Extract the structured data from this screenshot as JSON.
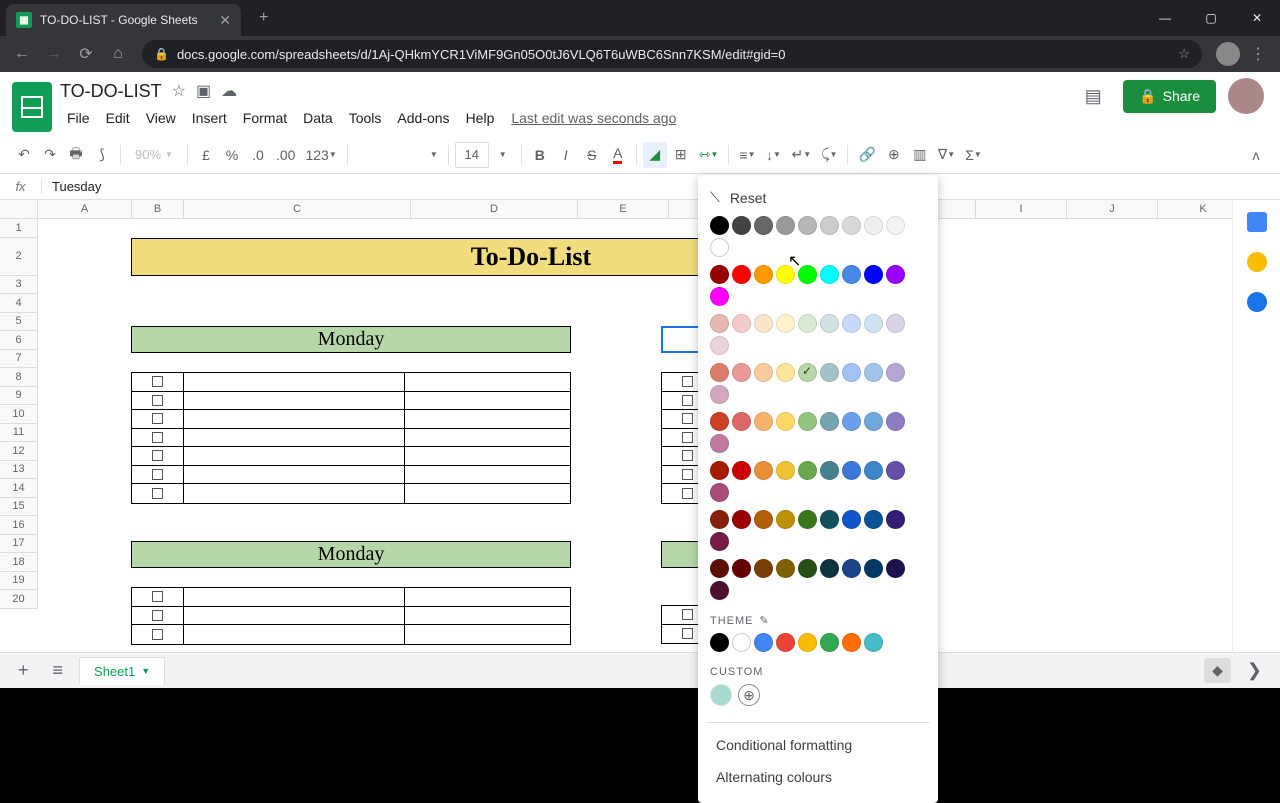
{
  "browser": {
    "tab_title": "TO-DO-LIST - Google Sheets",
    "url_display": "docs.google.com/spreadsheets/d/1Aj-QHkmYCR1ViMF9Gn05O0tJ6VLQ6T6uWBC6Snn7KSM/edit#gid=0"
  },
  "doc": {
    "title": "TO-DO-LIST",
    "menus": [
      "File",
      "Edit",
      "View",
      "Insert",
      "Format",
      "Data",
      "Tools",
      "Add-ons",
      "Help"
    ],
    "last_edit": "Last edit was seconds ago"
  },
  "share": {
    "label": "Share"
  },
  "toolbar": {
    "zoom": "90%",
    "font": "",
    "font_size": "14"
  },
  "fx": {
    "value": "Tuesday"
  },
  "columns": {
    "labels": [
      "A",
      "B",
      "C",
      "D",
      "E",
      "",
      "",
      "",
      "I",
      "J",
      "K"
    ],
    "widths": [
      94,
      52,
      227,
      167,
      91,
      81,
      113,
      113,
      91,
      91,
      91
    ]
  },
  "rows": {
    "count": 20,
    "tall_row": 2
  },
  "todotitle": "To-Do-List",
  "day_headers": {
    "left1": "Monday",
    "left2": "Monday"
  },
  "color_picker": {
    "reset": "Reset",
    "theme_label": "THEME",
    "custom_label": "CUSTOM",
    "conditional": "Conditional formatting",
    "alternating": "Alternating colours",
    "standard_grays": [
      "#000000",
      "#434343",
      "#666666",
      "#999999",
      "#b7b7b7",
      "#cccccc",
      "#d9d9d9",
      "#efefef",
      "#f3f3f3",
      "#ffffff"
    ],
    "standard_brights": [
      "#980000",
      "#ff0000",
      "#ff9900",
      "#ffff00",
      "#00ff00",
      "#00ffff",
      "#4a86e8",
      "#0000ff",
      "#9900ff",
      "#ff00ff"
    ],
    "shade_rows": [
      [
        "#e6b8af",
        "#f4cccc",
        "#fce5cd",
        "#fff2cc",
        "#d9ead3",
        "#d0e0e3",
        "#c9daf8",
        "#cfe2f3",
        "#d9d2e9",
        "#ead1dc"
      ],
      [
        "#dd7e6b",
        "#ea9999",
        "#f9cb9c",
        "#ffe599",
        "#b6d7a8",
        "#a2c4c9",
        "#a4c2f4",
        "#9fc5e8",
        "#b4a7d6",
        "#d5a6bd"
      ],
      [
        "#cc4125",
        "#e06666",
        "#f6b26b",
        "#ffd966",
        "#93c47d",
        "#76a5af",
        "#6d9eeb",
        "#6fa8dc",
        "#8e7cc3",
        "#c27ba0"
      ],
      [
        "#a61c00",
        "#cc0000",
        "#e69138",
        "#f1c232",
        "#6aa84f",
        "#45818e",
        "#3c78d8",
        "#3d85c6",
        "#674ea7",
        "#a64d79"
      ],
      [
        "#85200c",
        "#990000",
        "#b45f06",
        "#bf9000",
        "#38761d",
        "#134f5c",
        "#1155cc",
        "#0b5394",
        "#351c75",
        "#741b47"
      ],
      [
        "#5b0f00",
        "#660000",
        "#783f04",
        "#7f6000",
        "#274e13",
        "#0c343d",
        "#1c4587",
        "#073763",
        "#20124d",
        "#4c1130"
      ]
    ],
    "checked_index": {
      "row": 1,
      "col": 4
    },
    "theme_colors": [
      "#000000",
      "#ffffff",
      "#4285f4",
      "#ea4335",
      "#fbbc04",
      "#34a853",
      "#ff6d01",
      "#46bdc6"
    ],
    "custom_colors": [
      "#a8dad0"
    ]
  },
  "sheet_tab": {
    "name": "Sheet1"
  }
}
